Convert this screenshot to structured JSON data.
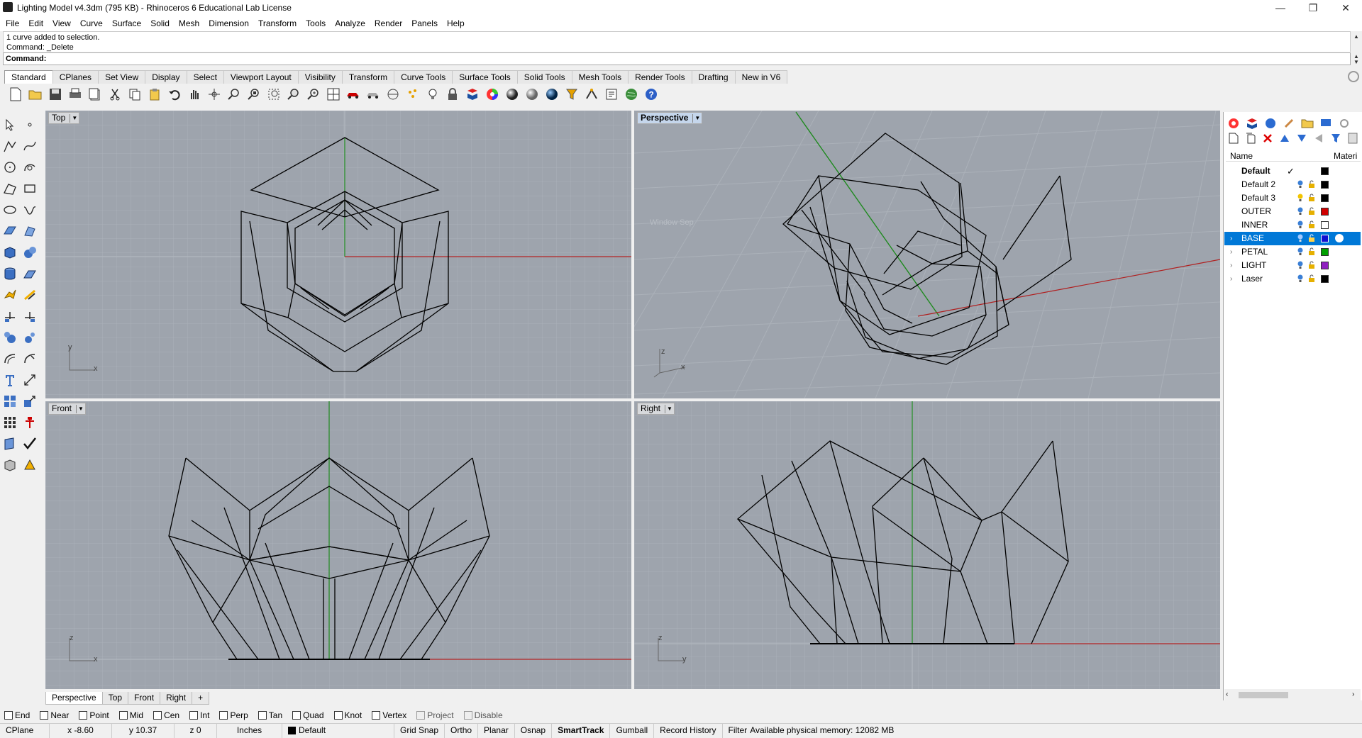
{
  "window": {
    "title": "Lighting Model v4.3dm (795 KB) - Rhinoceros 6 Educational Lab License",
    "minimize": "—",
    "maximize": "❐",
    "close": "✕"
  },
  "menu": [
    "File",
    "Edit",
    "View",
    "Curve",
    "Surface",
    "Solid",
    "Mesh",
    "Dimension",
    "Transform",
    "Tools",
    "Analyze",
    "Render",
    "Panels",
    "Help"
  ],
  "command": {
    "history": [
      "1 curve added to selection.",
      "Command: _Delete"
    ],
    "prompt": "Command:",
    "value": ""
  },
  "toolbar_tabs": [
    "Standard",
    "CPlanes",
    "Set View",
    "Display",
    "Select",
    "Viewport Layout",
    "Visibility",
    "Transform",
    "Curve Tools",
    "Surface Tools",
    "Solid Tools",
    "Mesh Tools",
    "Render Tools",
    "Drafting",
    "New in V6"
  ],
  "toolbar_icons": [
    "new-file-icon",
    "open-file-icon",
    "save-icon",
    "print-icon",
    "import-icon",
    "cut-icon",
    "copy-icon",
    "paste-icon",
    "undo-icon",
    "pan-icon",
    "rotate-view-icon",
    "zoom-icon",
    "zoom-window-icon",
    "zoom-extents-icon",
    "zoom-selected-icon",
    "zoom-all-icon",
    "four-viewports-icon",
    "car-render-icon",
    "shaded-icon",
    "cplane-icon",
    "point-cloud-icon",
    "light-icon",
    "lock-icon",
    "layer-icon",
    "color-wheel-icon",
    "sphere-icon",
    "render-sphere-icon",
    "blue-sphere-icon",
    "filter-icon",
    "grasshopper-icon",
    "script-icon",
    "globe-icon",
    "help-icon"
  ],
  "left_tools": [
    "select-arrow-icon",
    "point-icon",
    "polyline-icon",
    "curve-icon",
    "circle-icon",
    "arc-icon",
    "rectangle-icon",
    "polygon-icon",
    "ellipse-icon",
    "freeform-icon",
    "surface-icon",
    "loft-icon",
    "box-icon",
    "sphere-tool-icon",
    "cylinder-icon",
    "extrude-icon",
    "lightning-icon",
    "boolean-icon",
    "trim-icon",
    "split-icon",
    "fillet-icon",
    "mirror-icon",
    "offset-icon",
    "chamfer-icon",
    "text-icon",
    "dimension-icon",
    "array-icon",
    "scale-icon",
    "grid-array-icon",
    "gumball-icon",
    "edit-icon",
    "check-icon",
    "analyze-icon",
    "render-tool-icon"
  ],
  "viewports": {
    "top": {
      "label": "Top",
      "axis_a": "y",
      "axis_b": "x"
    },
    "perspective": {
      "label": "Perspective",
      "axis_a": "z",
      "axis_b": "x",
      "ghost": "Window Sep"
    },
    "front": {
      "label": "Front",
      "axis_a": "z",
      "axis_b": "x"
    },
    "right": {
      "label": "Right",
      "axis_a": "z",
      "axis_b": "y"
    }
  },
  "viewport_tabs": [
    "Perspective",
    "Top",
    "Front",
    "Right"
  ],
  "layers": {
    "header_name": "Name",
    "header_material": "Materi",
    "rows": [
      {
        "name": "Default",
        "current": true,
        "color": "#000000"
      },
      {
        "name": "Default 2",
        "color": "#000000"
      },
      {
        "name": "Default 3",
        "color": "#000000"
      },
      {
        "name": "OUTER",
        "color": "#d00000"
      },
      {
        "name": "INNER",
        "color": "#ffffff"
      },
      {
        "name": "BASE",
        "selected": true,
        "color": "#1010d0"
      },
      {
        "name": "PETAL",
        "color": "#00a000"
      },
      {
        "name": "LIGHT",
        "color": "#9020c0"
      },
      {
        "name": "Laser",
        "color": "#000000"
      }
    ],
    "checkmark": "✓"
  },
  "osnaps": [
    {
      "label": "End"
    },
    {
      "label": "Near"
    },
    {
      "label": "Point"
    },
    {
      "label": "Mid"
    },
    {
      "label": "Cen"
    },
    {
      "label": "Int"
    },
    {
      "label": "Perp"
    },
    {
      "label": "Tan"
    },
    {
      "label": "Quad"
    },
    {
      "label": "Knot"
    },
    {
      "label": "Vertex"
    },
    {
      "label": "Project",
      "disabled": true
    },
    {
      "label": "Disable",
      "disabled": true
    }
  ],
  "status": {
    "cplane": "CPlane",
    "x": "x -8.60",
    "y": "y 10.37",
    "z": "z 0",
    "units": "Inches",
    "layer": "Default",
    "grid_snap": "Grid Snap",
    "ortho": "Ortho",
    "planar": "Planar",
    "osnap": "Osnap",
    "smarttrack": "SmartTrack",
    "gumball": "Gumball",
    "record_history": "Record History",
    "filter": "Filter",
    "memory": "Available physical memory: 12082 MB"
  }
}
